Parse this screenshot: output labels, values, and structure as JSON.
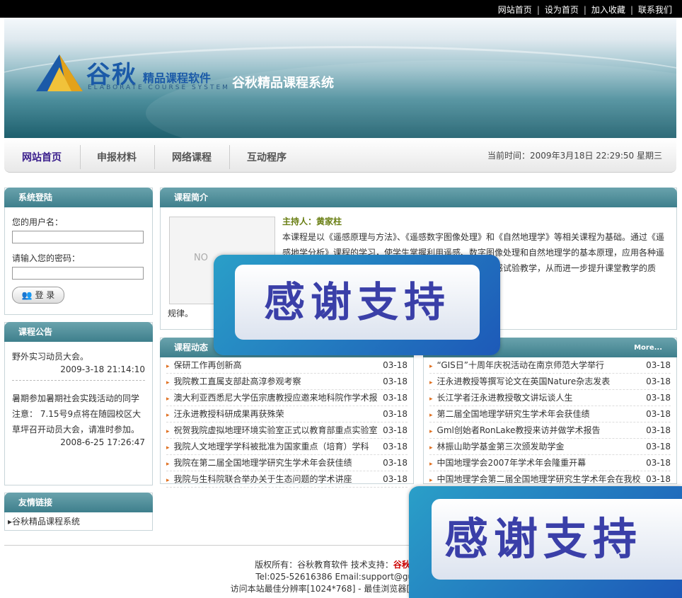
{
  "topnav": [
    "网站首页",
    "设为首页",
    "加入收藏",
    "联系我们"
  ],
  "banner": {
    "logo_main": "谷秋",
    "logo_sub": "精品课程软件",
    "logo_en": "ELABORATE COURSE SYSTEM",
    "site_title": "谷秋精品课程系统"
  },
  "nav": {
    "items": [
      "网站首页",
      "申报材料",
      "网络课程",
      "互动程序"
    ],
    "current_time": "当前时间：2009年3月18日 22:29:50 星期三"
  },
  "login": {
    "title": "系统登陆",
    "user_label": "您的用户名：",
    "pass_label": "请输入您的密码：",
    "button": "登 录"
  },
  "notice": {
    "title": "课程公告",
    "items": [
      {
        "text": "野外实习动员大会。",
        "time": "2009-3-18 21:14:10"
      },
      {
        "text": "暑期参加暑期社会实践活动的同学注意： 7.15号9点将在随园校区大草坪召开动员大会，请准时参加。",
        "time": "2008-6-25 17:26:47"
      }
    ]
  },
  "links": {
    "title": "友情链接",
    "items": [
      "谷秋精品课程系统"
    ]
  },
  "intro": {
    "title": "课程简介",
    "img_placeholder": "NO",
    "host": "主持人：黄家柱",
    "text": "本课程是以《遥感原理与方法》、《遥感数字图像处理》和《自然地理学》等相关课程为基础。通过《遥感地学分析》课程的学习，使学生掌握利用遥感、数字图像处理和自然地理学的基本原理，应用各种遥感信息进行定性、定量等相关的地学分析研究，并结合遥感试验教学，从而进一步提升课堂教学的质量。通",
    "tail": "规律。"
  },
  "news": {
    "title": "课程动态",
    "items": [
      {
        "title": "保研工作再创新高",
        "date": "03-18"
      },
      {
        "title": "我院教工直属支部赴高淳参观考察",
        "date": "03-18"
      },
      {
        "title": "澳大利亚西悉尼大学伍宗唐教授应邀来地科院作学术报",
        "date": "03-18"
      },
      {
        "title": "汪永进教授科研成果再获殊荣",
        "date": "03-18"
      },
      {
        "title": "祝贺我院虚拟地理环境实验室正式以教育部重点实验室",
        "date": "03-18"
      },
      {
        "title": "我院人文地理学学科被批准为国家重点（培育）学科",
        "date": "03-18"
      },
      {
        "title": "我院在第二届全国地理学研究生学术年会获佳绩",
        "date": "03-18"
      },
      {
        "title": "我院与生科院联合举办关于生态问题的学术讲座",
        "date": "03-18"
      }
    ]
  },
  "news2": {
    "more": "More...",
    "items": [
      {
        "title": "“GIS日”十周年庆祝活动在南京师范大学举行",
        "date": "03-18"
      },
      {
        "title": "汪永进教授等撰写论文在英国Nature杂志发表",
        "date": "03-18"
      },
      {
        "title": "长江学者汪永进教授敬文讲坛谈人生",
        "date": "03-18"
      },
      {
        "title": "第二届全国地理学研究生学术年会获佳绩",
        "date": "03-18"
      },
      {
        "title": "Gml创始者RonLake教授来访并做学术报告",
        "date": "03-18"
      },
      {
        "title": "林振山助学基金第三次颁发助学金",
        "date": "03-18"
      },
      {
        "title": "中国地理学会2007年学术年会隆重开幕",
        "date": "03-18"
      },
      {
        "title": "中国地理学会第二届全国地理学研究生学术年会在我校",
        "date": "03-18"
      }
    ]
  },
  "footer": {
    "line1": "版权所有：谷秋教育软件  技术支持：",
    "line1_red": "谷秋精品",
    "line2": "Tel:025-52616386  Email:support@guqiu",
    "line3": "访问本站最佳分辨率[1024*768] - 最佳浏览器[IE7] - 最佳"
  },
  "overlay": {
    "text": "感谢支持"
  }
}
